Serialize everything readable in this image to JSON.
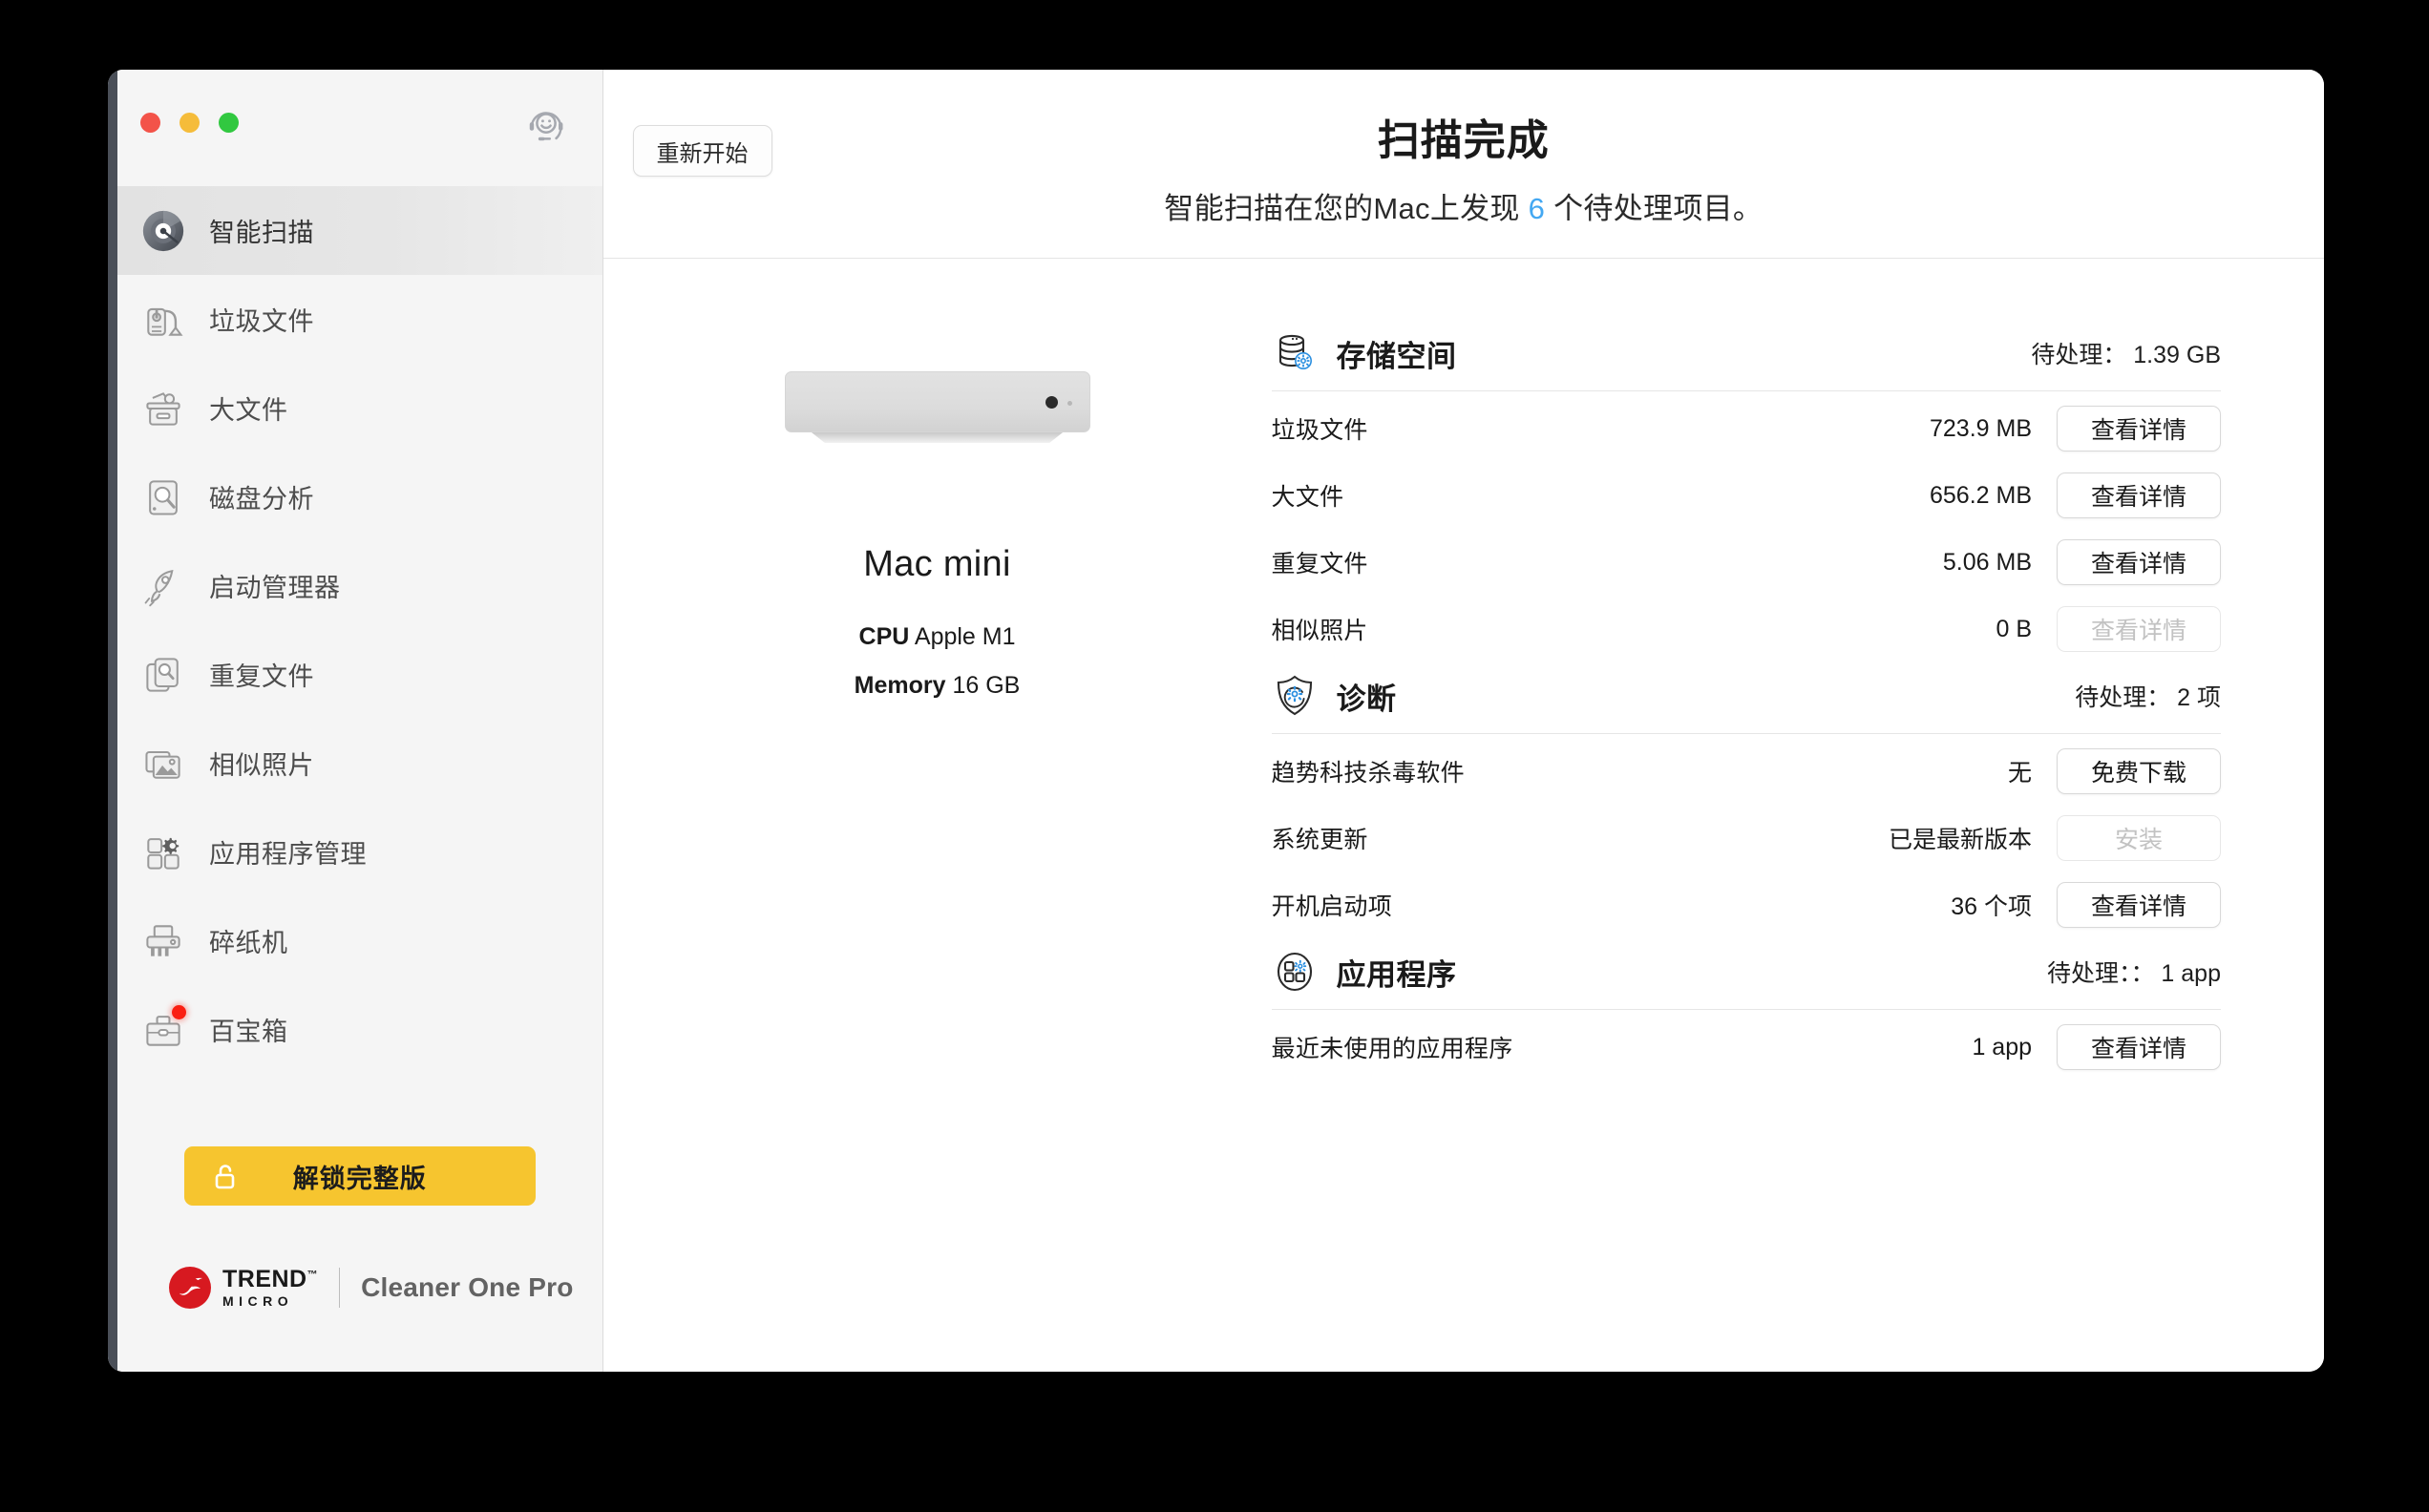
{
  "window": {
    "traffic_lights": [
      "close",
      "minimize",
      "zoom"
    ],
    "support_icon": "support-headset-icon"
  },
  "sidebar": {
    "items": [
      {
        "label": "智能扫描",
        "icon": "smart-scan-icon",
        "active": true,
        "badge": false
      },
      {
        "label": "垃圾文件",
        "icon": "junk-files-icon",
        "active": false,
        "badge": false
      },
      {
        "label": "大文件",
        "icon": "big-files-icon",
        "active": false,
        "badge": false
      },
      {
        "label": "磁盘分析",
        "icon": "disk-map-icon",
        "active": false,
        "badge": false
      },
      {
        "label": "启动管理器",
        "icon": "startup-manager-icon",
        "active": false,
        "badge": false
      },
      {
        "label": "重复文件",
        "icon": "duplicate-files-icon",
        "active": false,
        "badge": false
      },
      {
        "label": "相似照片",
        "icon": "similar-photos-icon",
        "active": false,
        "badge": false
      },
      {
        "label": "应用程序管理",
        "icon": "app-manager-icon",
        "active": false,
        "badge": false
      },
      {
        "label": "碎纸机",
        "icon": "file-shredder-icon",
        "active": false,
        "badge": false
      },
      {
        "label": "百宝箱",
        "icon": "toolbox-icon",
        "active": false,
        "badge": true
      }
    ],
    "unlock_button": {
      "label": "解锁完整版",
      "icon": "unlock-icon",
      "color": "#f6c52f"
    },
    "brand": {
      "logo": "trend-micro-logo",
      "name_line1": "TREND",
      "name_line2": "MICRO",
      "trademark": "™",
      "product": "Cleaner One Pro"
    }
  },
  "header": {
    "restart_button": "重新开始",
    "title": "扫描完成",
    "subtitle_before": "智能扫描在您的Mac上发现",
    "subtitle_count": "6",
    "subtitle_after": "个待处理项目。",
    "accent_color": "#44a8f2"
  },
  "device": {
    "art": "mac-mini-illustration",
    "name": "Mac mini",
    "specs": [
      {
        "key": "CPU",
        "value": "Apple M1"
      },
      {
        "key": "Memory",
        "value": "16 GB"
      }
    ]
  },
  "results": {
    "groups": [
      {
        "icon": "storage-database-icon",
        "title": "存储空间",
        "pending": "待处理： 1.39 GB",
        "rows": [
          {
            "label": "垃圾文件",
            "value": "723.9 MB",
            "button": "查看详情",
            "disabled": false
          },
          {
            "label": "大文件",
            "value": "656.2 MB",
            "button": "查看详情",
            "disabled": false
          },
          {
            "label": "重复文件",
            "value": "5.06 MB",
            "button": "查看详情",
            "disabled": false
          },
          {
            "label": "相似照片",
            "value": "0 B",
            "button": "查看详情",
            "disabled": true
          }
        ]
      },
      {
        "icon": "diagnostics-shield-icon",
        "title": "诊断",
        "pending": "待处理： 2 项",
        "rows": [
          {
            "label": "趋势科技杀毒软件",
            "value": "无",
            "button": "免费下载",
            "disabled": false
          },
          {
            "label": "系统更新",
            "value": "已是最新版本",
            "button": "安装",
            "disabled": true
          },
          {
            "label": "开机启动项",
            "value": "36 个项",
            "button": "查看详情",
            "disabled": false
          }
        ]
      },
      {
        "icon": "applications-grid-icon",
        "title": "应用程序",
        "pending": "待处理：： 1 app",
        "rows": [
          {
            "label": "最近未使用的应用程序",
            "value": "1 app",
            "button": "查看详情",
            "disabled": false
          }
        ]
      }
    ]
  }
}
